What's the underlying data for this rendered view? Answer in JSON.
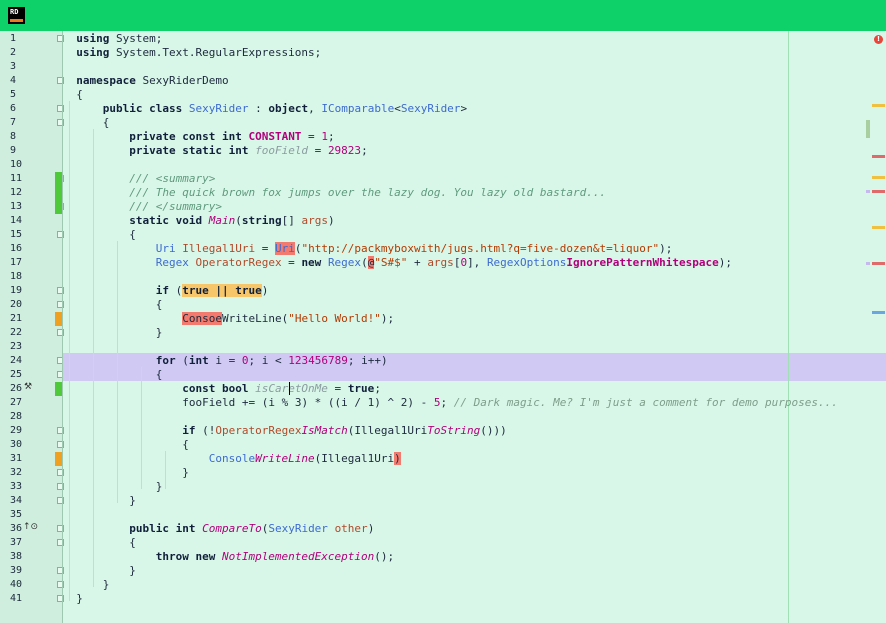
{
  "app": {
    "logo_text": "RD",
    "accent": "#0fd16a"
  },
  "editor": {
    "line_numbers": [
      "1",
      "2",
      "3",
      "4",
      "5",
      "6",
      "7",
      "8",
      "9",
      "10",
      "11",
      "12",
      "13",
      "14",
      "15",
      "16",
      "17",
      "18",
      "19",
      "20",
      "21",
      "22",
      "23",
      "24",
      "25",
      "26",
      "27",
      "28",
      "29",
      "30",
      "31",
      "32",
      "33",
      "34",
      "35",
      "36",
      "37",
      "38",
      "39",
      "40",
      "41"
    ],
    "error_badge": "!",
    "gutter_icons": {
      "line26": "hammer-icon",
      "line36": "implementation-icon"
    }
  },
  "code": {
    "l1": {
      "kw": "using",
      "rest": " System;"
    },
    "l2": {
      "kw": "using",
      "rest": " System.Text.RegularExpressions;"
    },
    "l4": {
      "kw": "namespace",
      "rest": " SexyRiderDemo"
    },
    "l5": "{",
    "l6": {
      "kw1": "public class",
      "name": " SexyRider",
      "sep": " : ",
      "kw2": "object",
      ",": ", ",
      "iface": "IComparable",
      "lt": "<",
      "gen": "SexyRider",
      "gt": ">"
    },
    "l7": "{",
    "l8": {
      "kw": "private const int",
      "sp": " ",
      "name": "CONSTANT",
      "eq": " = ",
      "num": "1",
      ";": ";"
    },
    "l9": {
      "kw": "private static int",
      "sp": " ",
      "name": "fooField",
      "eq": " = ",
      "num": "29823",
      ";": ";"
    },
    "l11": "/// <summary>",
    "l12": "/// The quick brown fox jumps over the lazy dog. You lazy old bastard...",
    "l13": "/// </summary>",
    "l14": {
      "kw": "static void",
      "sp": " ",
      "name": "Main",
      "open": "(",
      "kw2": "string",
      "br": "[] ",
      "prm": "args",
      "close": ")"
    },
    "l15": "{",
    "l16": {
      "ty": "Uri",
      "sp": " ",
      "var": "Illegal1Uri",
      "eq": " = ",
      "err": "Uri",
      "open": "(",
      "str": "\"http://packmyboxwith/jugs.html?q=five-dozen&t=liquor\"",
      "close": ");"
    },
    "l17": {
      "ty": "Regex",
      "sp": " ",
      "var": "OperatorRegex",
      "eq": " = ",
      "kw": "new",
      "sp2": " ",
      "ty2": "Regex",
      "open": "(",
      "err": "@",
      "str": "\"S#$\"",
      "plus": " + ",
      "prm": "args",
      "idx": "[",
      "num": "0",
      "idx2": "], ",
      "ty3": "RegexOptions",
      ".": ".",
      "const": "IgnorePatternWhitespace",
      "close": ");"
    },
    "l19": {
      "kw": "if",
      "open": " (",
      "warn": "true || true",
      "close": ")"
    },
    "l20": "{",
    "l21": {
      "err": "Consoe",
      ".": ".",
      "call": "WriteLine",
      "open": "(",
      "str": "\"Hello World!\"",
      "close": ");"
    },
    "l22": "}",
    "l24": {
      "kw": "for",
      "open": " (",
      "kw2": "int",
      "rest1": " i = ",
      "num1": "0",
      "rest2": "; i < ",
      "num2": "123456789",
      "rest3": "; i++)"
    },
    "l25": "{",
    "l26": {
      "kw": "const bool",
      "sp": " ",
      "name": "isCaretOnMe",
      "eq": " = ",
      "kw2": "true",
      ";": ";"
    },
    "l27": {
      "var": "fooField",
      "op": " += ",
      "p1": "(i % 3) * ((i / 1) ^ 2) - ",
      "num": "5",
      "sc": "; ",
      "cmt": "// Dark magic. Me? I'm just a comment for demo purposes..."
    },
    "l29": {
      "kw": "if",
      "open": " (!",
      "var": "OperatorRegex",
      ".": ".",
      "m": "IsMatch",
      "o2": "(",
      "v2": "Illegal1Uri",
      ".2": ".",
      "m2": "ToString",
      "close": "()))"
    },
    "l30": "{",
    "l31": {
      "ty": "Console",
      ".": ".",
      "m": "WriteLine",
      "open": "(",
      "var": "Illegal1Uri",
      "err": ")"
    },
    "l32": "}",
    "l33": "}",
    "l34": "}",
    "l36": {
      "kw": "public int",
      "sp": " ",
      "m": "CompareTo",
      "open": "(",
      "ty": "SexyRider",
      "sp2": " ",
      "prm": "other",
      "close": ")"
    },
    "l37": "{",
    "l38": {
      "kw": "throw new",
      "sp": " ",
      "ty": "NotImplementedException",
      "close": "();"
    },
    "l39": "}",
    "l40": "}",
    "l41": "}"
  },
  "scroll_markers": [
    {
      "kind": "warning",
      "color": "#f0c040"
    },
    {
      "kind": "info",
      "color": "#a9cfa0"
    },
    {
      "kind": "error",
      "color": "#e06a6a"
    },
    {
      "kind": "warning",
      "color": "#f0c040"
    },
    {
      "kind": "error",
      "color": "#e06a6a"
    },
    {
      "kind": "info",
      "color": "#c6b9f0"
    },
    {
      "kind": "warning",
      "color": "#f0c040"
    },
    {
      "kind": "error",
      "color": "#e06a6a"
    },
    {
      "kind": "info",
      "color": "#c6b9f0"
    },
    {
      "kind": "info",
      "color": "#6aa6e0"
    }
  ]
}
